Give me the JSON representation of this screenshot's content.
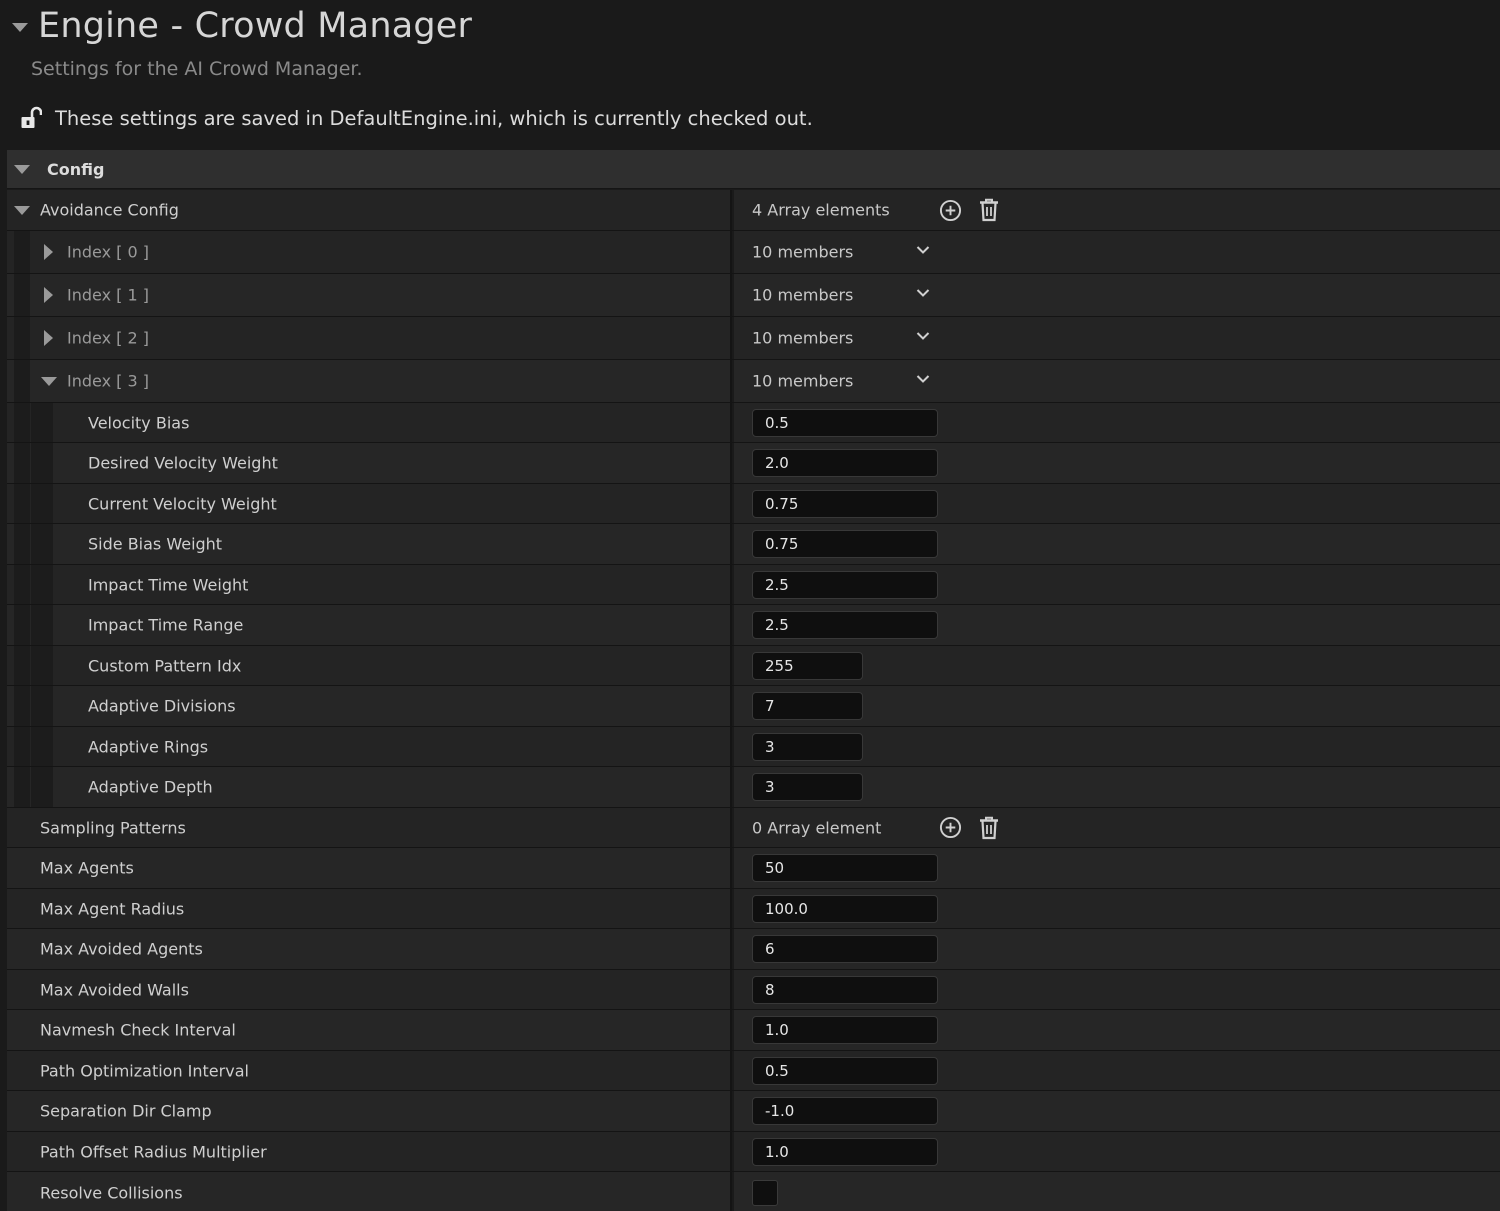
{
  "header": {
    "title": "Engine - Crowd Manager",
    "subtitle": "Settings for the AI Crowd Manager.",
    "notice": "These settings are saved in DefaultEngine.ini, which is currently checked out."
  },
  "config": {
    "label": "Config"
  },
  "avoidance": {
    "label": "Avoidance Config",
    "count": "4 Array elements",
    "indices": [
      {
        "label": "Index [ 0 ]",
        "value": "10 members"
      },
      {
        "label": "Index [ 1 ]",
        "value": "10 members"
      },
      {
        "label": "Index [ 2 ]",
        "value": "10 members"
      },
      {
        "label": "Index [ 3 ]",
        "value": "10 members"
      }
    ],
    "members": [
      {
        "label": "Velocity Bias",
        "value": "0.5"
      },
      {
        "label": "Desired Velocity Weight",
        "value": "2.0"
      },
      {
        "label": "Current Velocity Weight",
        "value": "0.75"
      },
      {
        "label": "Side Bias Weight",
        "value": "0.75"
      },
      {
        "label": "Impact Time Weight",
        "value": "2.5"
      },
      {
        "label": "Impact Time Range",
        "value": "2.5"
      },
      {
        "label": "Custom Pattern Idx",
        "value": "255"
      },
      {
        "label": "Adaptive Divisions",
        "value": "7"
      },
      {
        "label": "Adaptive Rings",
        "value": "3"
      },
      {
        "label": "Adaptive Depth",
        "value": "3"
      }
    ]
  },
  "sampling": {
    "label": "Sampling Patterns",
    "count": "0 Array element"
  },
  "props": [
    {
      "label": "Max Agents",
      "value": "50"
    },
    {
      "label": "Max Agent Radius",
      "value": "100.0"
    },
    {
      "label": "Max Avoided Agents",
      "value": "6"
    },
    {
      "label": "Max Avoided Walls",
      "value": "8"
    },
    {
      "label": "Navmesh Check Interval",
      "value": "1.0"
    },
    {
      "label": "Path Optimization Interval",
      "value": "0.5"
    },
    {
      "label": "Separation Dir Clamp",
      "value": "-1.0"
    },
    {
      "label": "Path Offset Radius Multiplier",
      "value": "1.0"
    }
  ],
  "resolve": {
    "label": "Resolve Collisions",
    "checked": false
  }
}
